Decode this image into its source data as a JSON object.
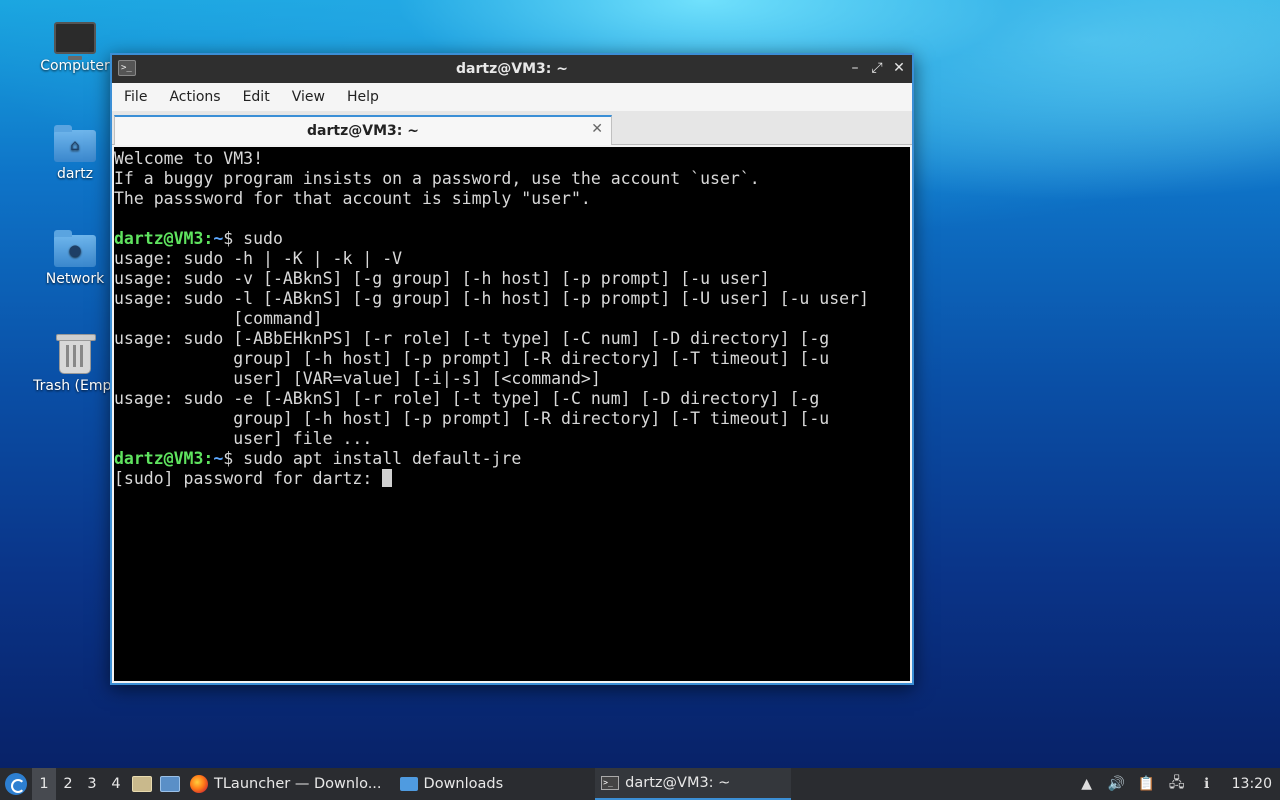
{
  "desktop": {
    "icons": [
      {
        "label": "Computer",
        "icon": "computer-icon"
      },
      {
        "label": "dartz",
        "icon": "home-folder-icon"
      },
      {
        "label": "Network",
        "icon": "network-folder-icon"
      },
      {
        "label": "Trash (Empt",
        "icon": "trash-icon"
      }
    ]
  },
  "window": {
    "title": "dartz@VM3: ~",
    "menu": [
      "File",
      "Actions",
      "Edit",
      "View",
      "Help"
    ],
    "tab": {
      "label": "dartz@VM3: ~"
    },
    "prompt": {
      "user": "dartz@VM3",
      "sep": ":",
      "path": "~",
      "symbol": "$ "
    },
    "lines": [
      "Welcome to VM3!",
      "If a buggy program insists on a password, use the account `user`.",
      "The passsword for that account is simply \"user\".",
      "",
      "usage: sudo -h | -K | -k | -V",
      "usage: sudo -v [-ABknS] [-g group] [-h host] [-p prompt] [-u user]",
      "usage: sudo -l [-ABknS] [-g group] [-h host] [-p prompt] [-U user] [-u user]",
      "            [command]",
      "usage: sudo [-ABbEHknPS] [-r role] [-t type] [-C num] [-D directory] [-g",
      "            group] [-h host] [-p prompt] [-R directory] [-T timeout] [-u",
      "            user] [VAR=value] [-i|-s] [<command>]",
      "usage: sudo -e [-ABknS] [-r role] [-t type] [-C num] [-D directory] [-g",
      "            group] [-h host] [-p prompt] [-R directory] [-T timeout] [-u",
      "            user] file ...",
      "[sudo] password for dartz: "
    ],
    "commands": [
      "sudo",
      "sudo apt install default-jre"
    ]
  },
  "taskbar": {
    "workspaces": [
      "1",
      "2",
      "3",
      "4"
    ],
    "tasks": [
      {
        "label": "TLauncher — Downlo...",
        "icon": "firefox-icon"
      },
      {
        "label": "Downloads",
        "icon": "folder-icon"
      },
      {
        "label": "dartz@VM3: ~",
        "icon": "terminal-icon"
      }
    ],
    "clock": "13:20"
  }
}
